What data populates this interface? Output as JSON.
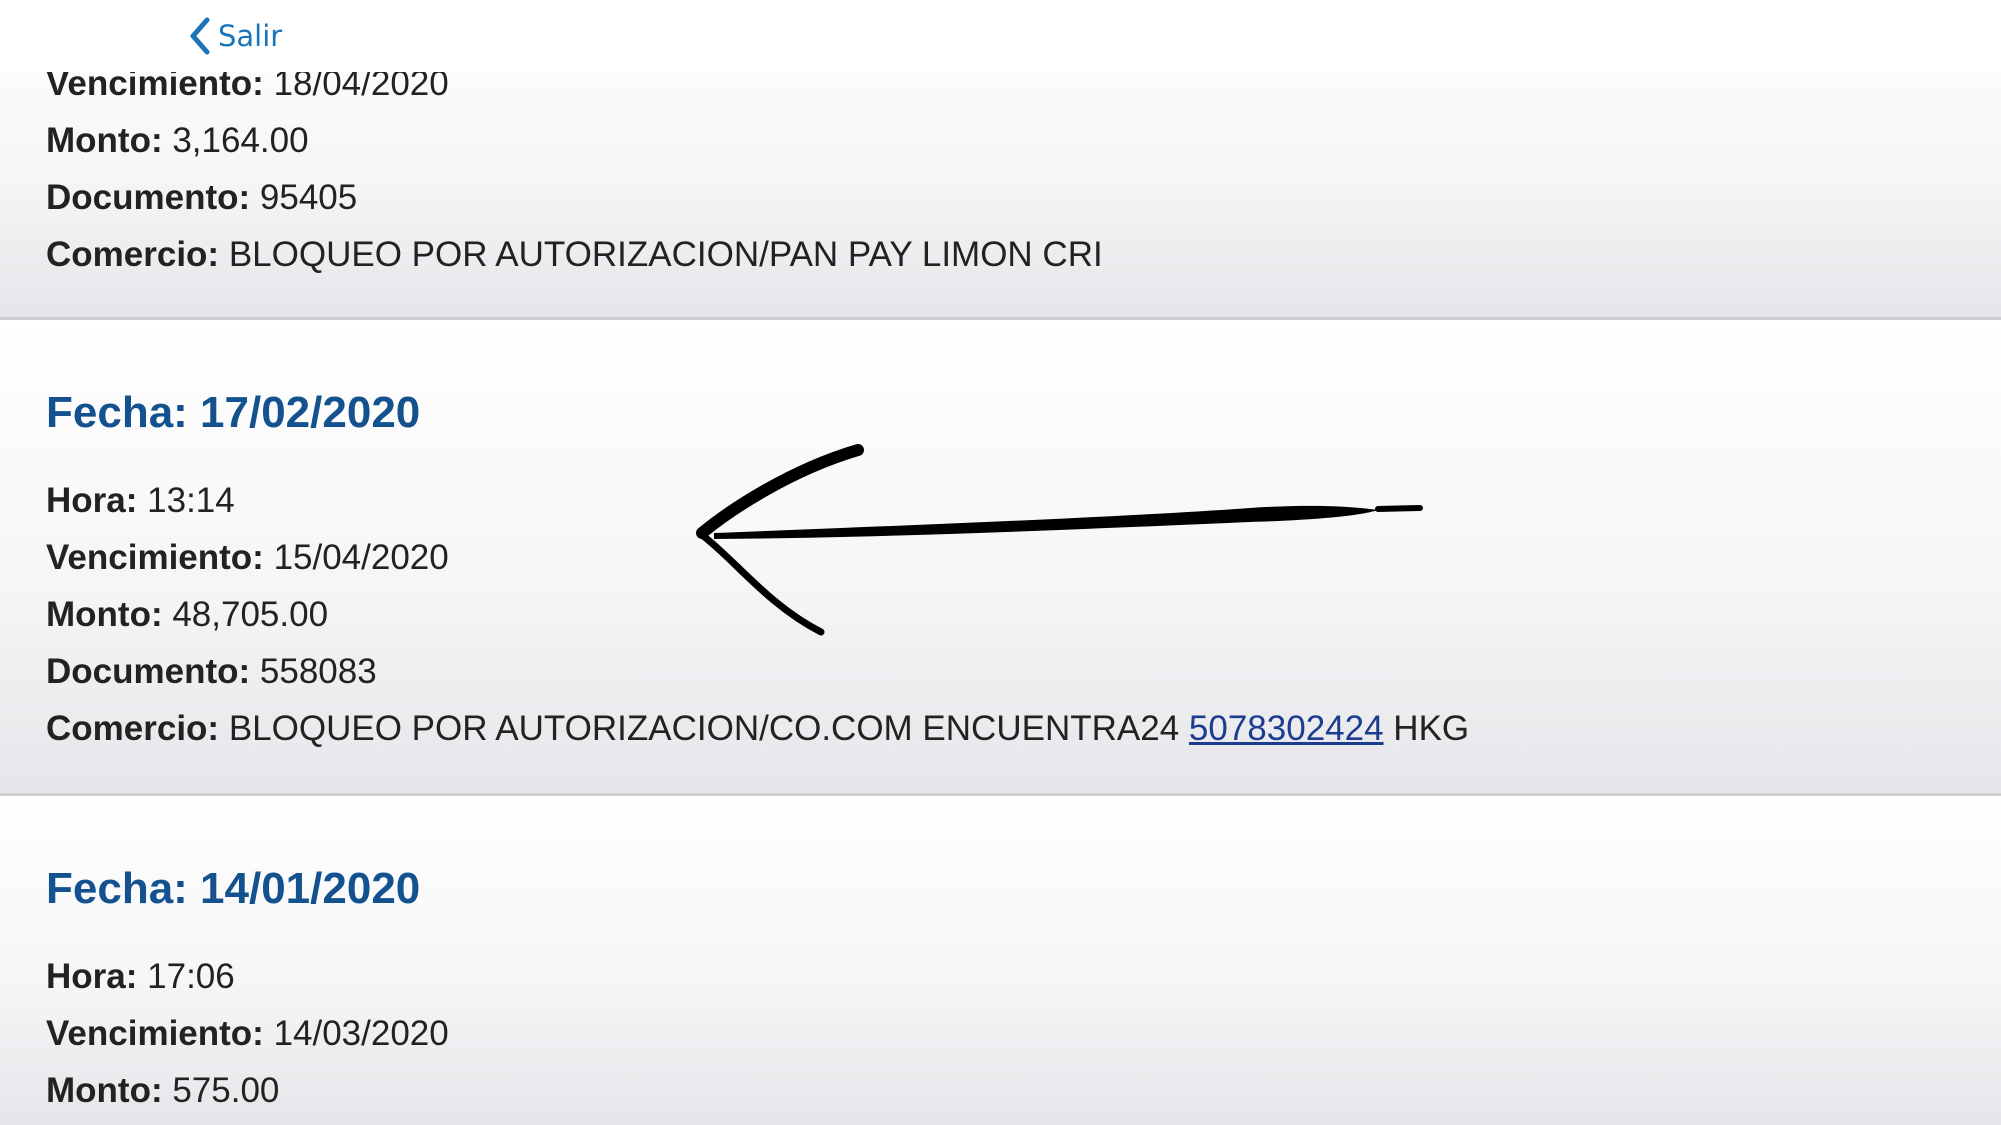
{
  "nav": {
    "back_label": "Salir",
    "accent_color": "#1a74ba"
  },
  "transactions": [
    {
      "vencimiento_label": "Vencimiento:",
      "vencimiento": "18/04/2020",
      "monto_label": "Monto:",
      "monto": "3,164.00",
      "documento_label": "Documento:",
      "documento": "95405",
      "comercio_label": "Comercio:",
      "comercio": "BLOQUEO POR AUTORIZACION/PAN PAY LIMON CRI"
    },
    {
      "fecha_title": "Fecha: 17/02/2020",
      "hora_label": "Hora:",
      "hora": "13:14",
      "vencimiento_label": "Vencimiento:",
      "vencimiento": "15/04/2020",
      "monto_label": "Monto:",
      "monto": "48,705.00",
      "documento_label": "Documento:",
      "documento": "558083",
      "comercio_label": "Comercio:",
      "comercio_prefix": "BLOQUEO POR AUTORIZACION/CO.COM ENCUENTRA24",
      "comercio_phone": "5078302424",
      "comercio_suffix": "HKG"
    },
    {
      "fecha_title": "Fecha: 14/01/2020",
      "hora_label": "Hora:",
      "hora": "17:06",
      "vencimiento_label": "Vencimiento:",
      "vencimiento": "14/03/2020",
      "monto_label": "Monto:",
      "monto": "575.00"
    }
  ],
  "colors": {
    "title_blue": "#14528f",
    "link_blue": "#1c3d8f",
    "text": "#222222",
    "annotation": "#000000"
  },
  "annotation": {
    "icon": "hand-drawn-arrow-icon"
  }
}
